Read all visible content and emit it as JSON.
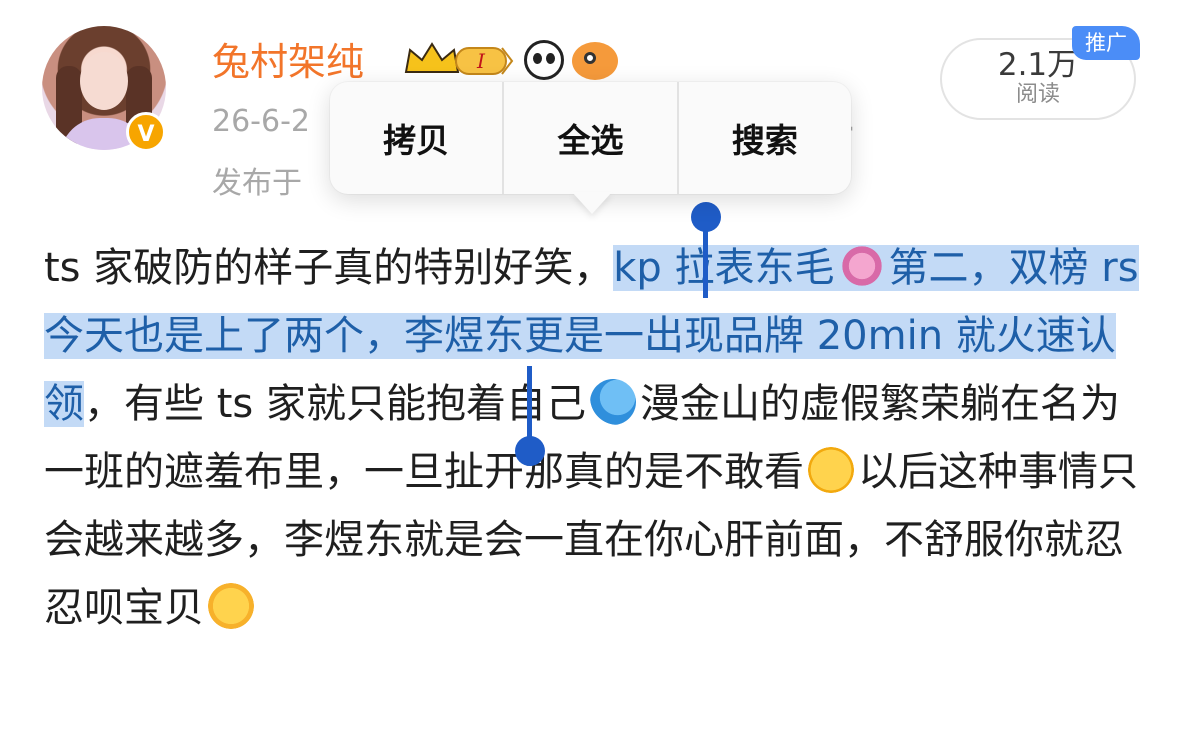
{
  "post": {
    "author": "兔村架纯",
    "date_partial": "26-6-2",
    "from_partial": "发布于",
    "meta_dot": "·",
    "reads_count": "2.1万",
    "reads_label": "阅读",
    "promo_tag": "推广",
    "badges": [
      "crown-level-badge",
      "panda-icon",
      "fish-icon"
    ]
  },
  "context_menu": {
    "items": [
      "拷贝",
      "全选",
      "搜索"
    ]
  },
  "content": {
    "seg1": "ts 家破防的样子真的特别好笑，",
    "seg2_selected_a": "kp 拉表东毛",
    "seg2_selected_b": "第二，双榜 rs 今天也是上了两个，李煜东更是一出现品牌 20min 就火速认领",
    "seg3": "，有些 ts 家就只能抱着自己",
    "seg4": "漫金山的虚假繁荣躺在名为一班的遮羞布里，一旦扯开那真的是不敢看",
    "seg5": "以后这种事情只会越来越多，李煜东就是会一直在你心肝前面，不舒服你就忍忍呗宝贝"
  },
  "colors": {
    "username": "#f2752a",
    "selection_bg": "#c3daf6",
    "selection_text": "#1e5fa8",
    "handle": "#1f5cc7",
    "promo": "#4b8df7",
    "verified_badge": "#f7a500"
  }
}
